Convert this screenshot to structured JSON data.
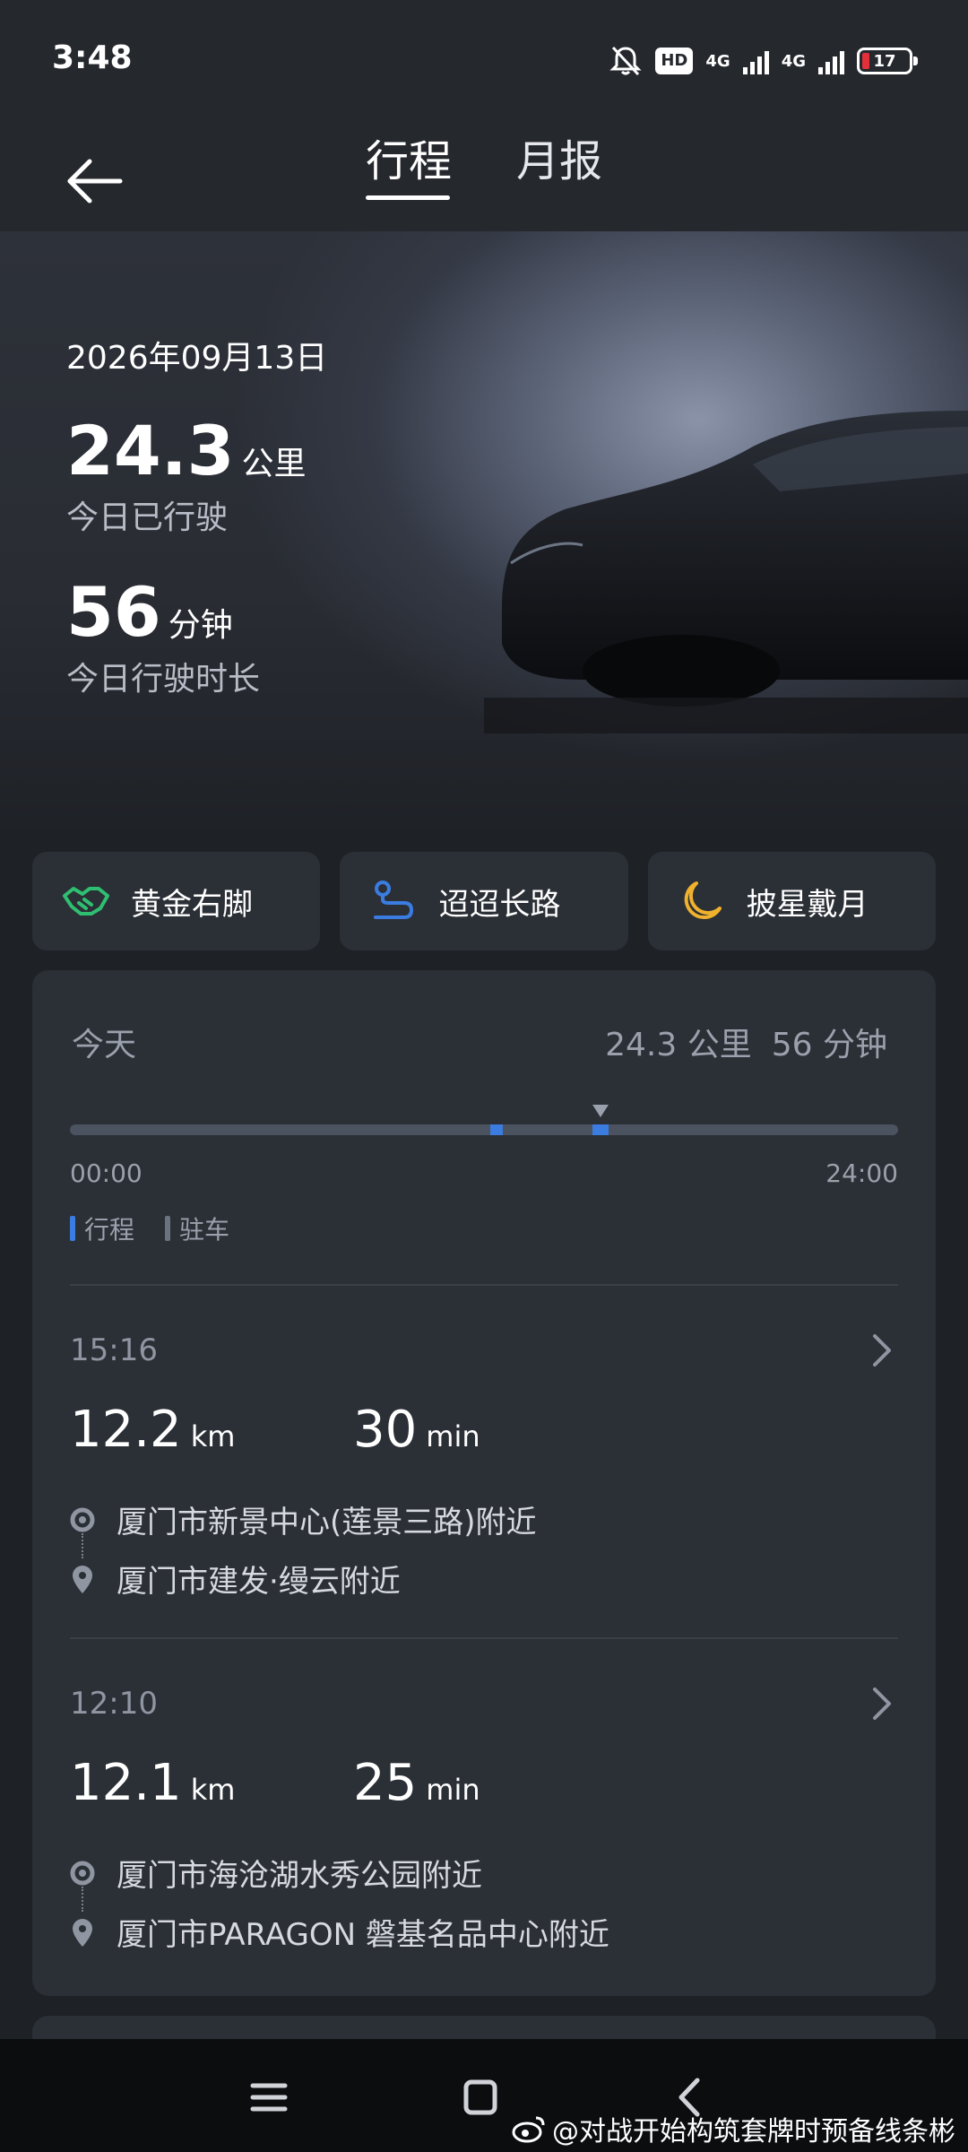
{
  "status_bar": {
    "time": "3:48",
    "hd_label": "HD",
    "net1": "4G",
    "net2": "4G",
    "battery": "17"
  },
  "header": {
    "tabs": [
      {
        "label": "行程",
        "active": true
      },
      {
        "label": "月报",
        "active": false
      }
    ]
  },
  "hero": {
    "date": "2026年09月13日",
    "distance_value": "24.3",
    "distance_unit": "公里",
    "distance_caption": "今日已行驶",
    "duration_value": "56",
    "duration_unit": "分钟",
    "duration_caption": "今日行驶时长"
  },
  "badges": [
    {
      "label": "黄金右脚",
      "icon": "handshake-icon",
      "color": "#2fbf71"
    },
    {
      "label": "迢迢长路",
      "icon": "route-icon",
      "color": "#3a7ce0"
    },
    {
      "label": "披星戴月",
      "icon": "moon-icon",
      "color": "#f0b22d"
    }
  ],
  "today": {
    "label": "今天",
    "total_distance": "24.3 公里",
    "total_duration": "56 分钟",
    "timeline_start": "00:00",
    "timeline_end": "24:00",
    "legend_trip": "行程",
    "legend_parking": "驻车",
    "trip_color": "#3a7ce0",
    "parking_color": "#6b7280"
  },
  "trips": [
    {
      "time": "15:16",
      "distance": "12.2",
      "distance_unit": "km",
      "duration": "30",
      "duration_unit": "min",
      "from": "厦门市新景中心(莲景三路)附近",
      "to": "厦门市建发·缦云附近"
    },
    {
      "time": "12:10",
      "distance": "12.1",
      "distance_unit": "km",
      "duration": "25",
      "duration_unit": "min",
      "from": "厦门市海沧湖水秀公园附近",
      "to": "厦门市PARAGON 磐基名品中心附近"
    }
  ],
  "watermark": "@对战开始构筑套牌时预备线条彬"
}
